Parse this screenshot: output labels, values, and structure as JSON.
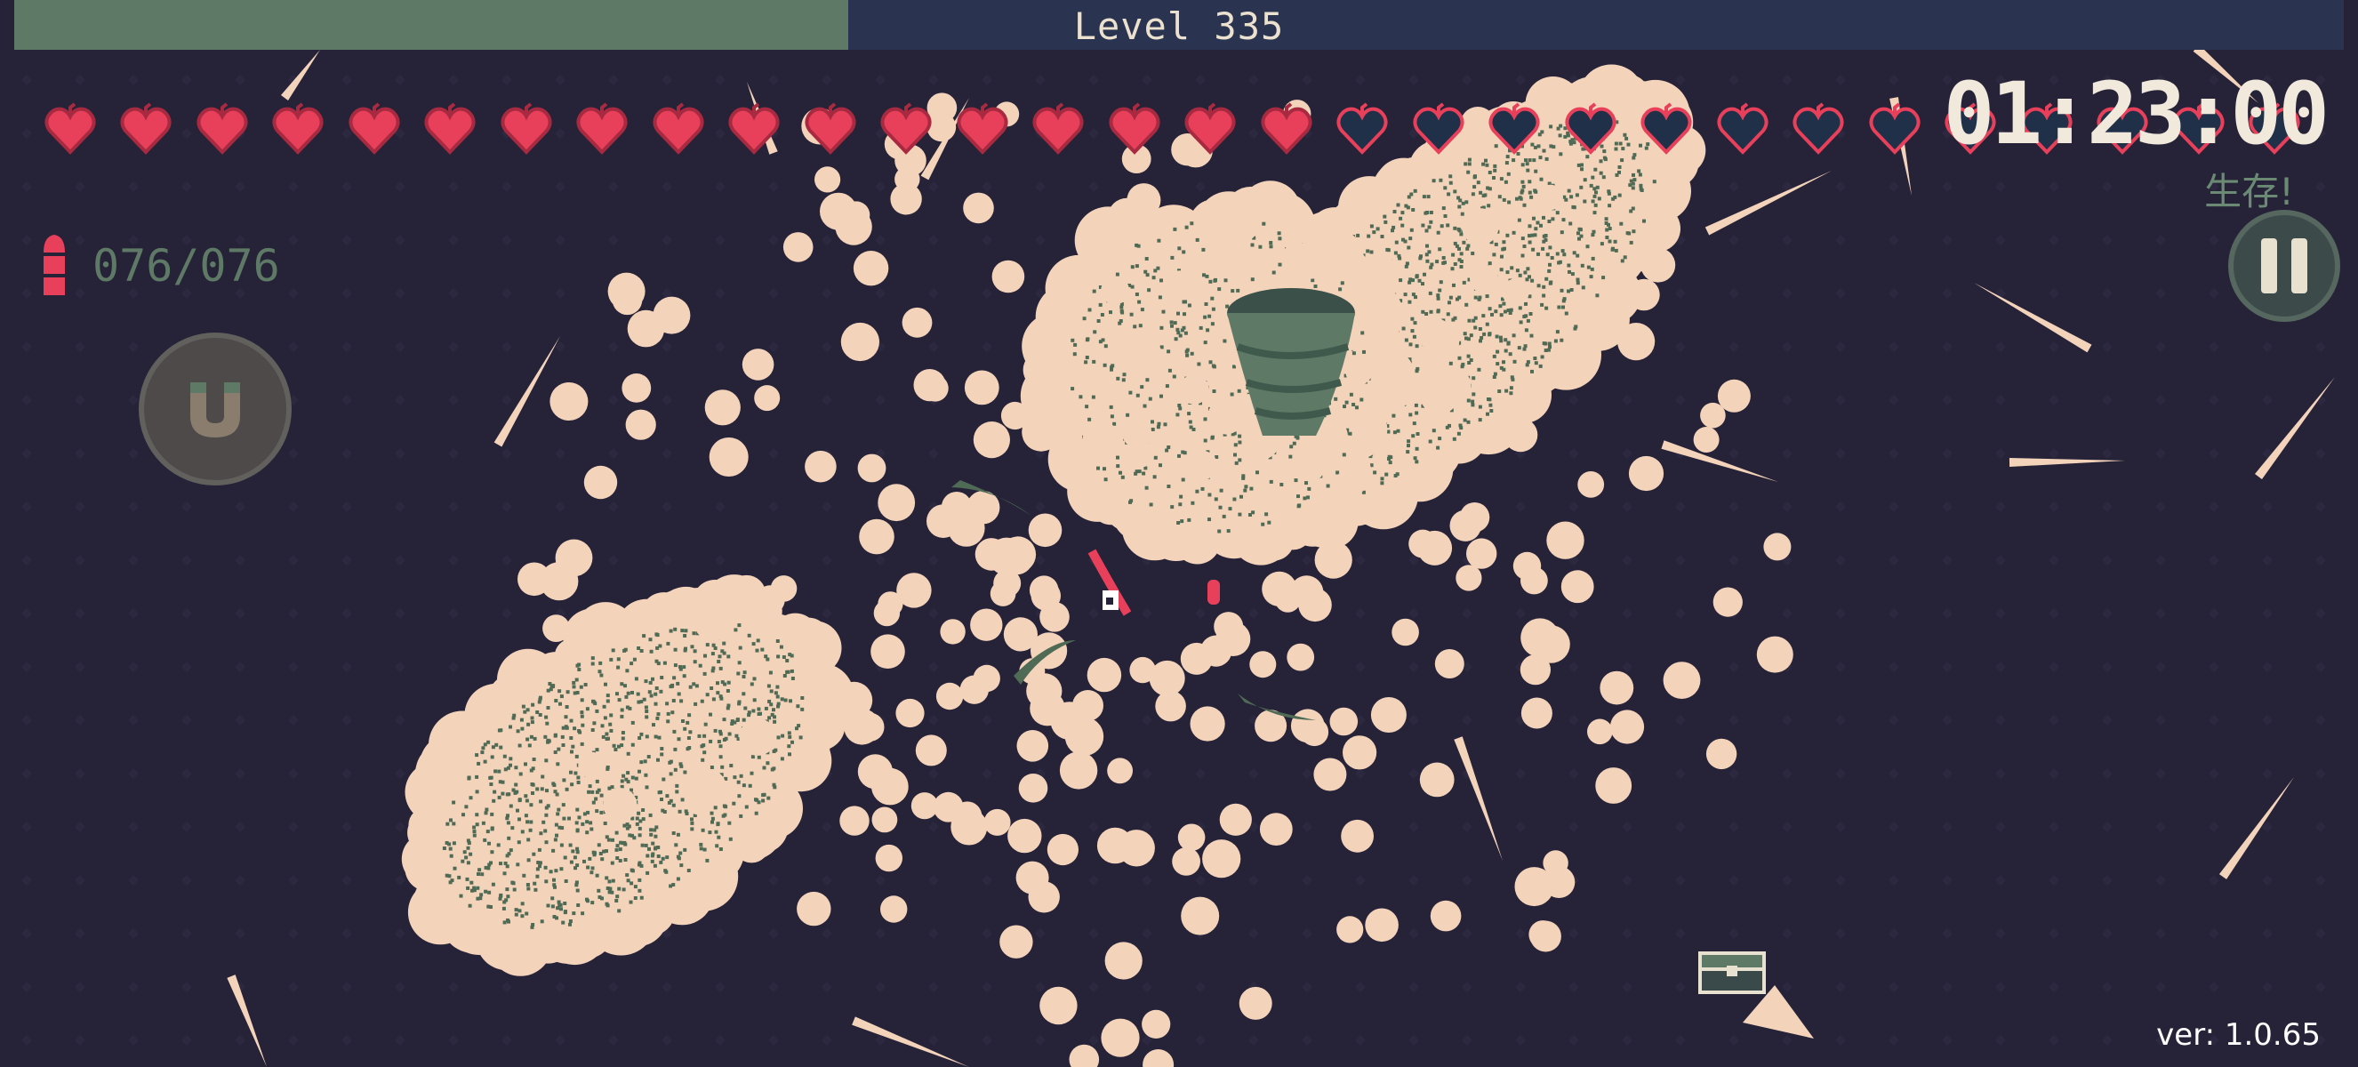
{
  "hud": {
    "level_label": "Level  335",
    "level_progress": 0.358,
    "hearts_filled": 17,
    "hearts_empty": 13,
    "timer": "01:23:00",
    "survive_text": "生存!",
    "ammo": "076/076",
    "version": "ver: 1.0.65"
  },
  "colors": {
    "background": "#262338",
    "heart_full": "#e8405a",
    "heart_empty": "#1f3048",
    "orb": "#f4d3bb",
    "moss": "#4f6b55",
    "xp_fill": "#5e7a66",
    "xp_track": "#2a3450"
  },
  "icons": {
    "heart": "heart-icon",
    "ammo": "bullet-icon",
    "magnet": "magnet-icon",
    "pause": "pause-icon",
    "chest": "treasure-chest-icon"
  }
}
